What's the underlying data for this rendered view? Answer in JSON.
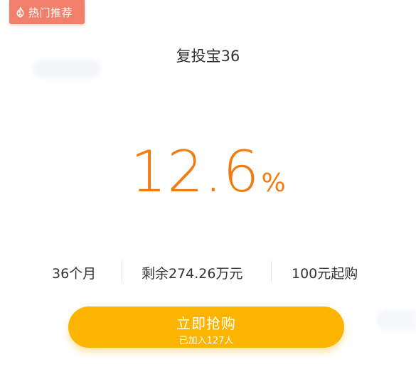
{
  "badge": {
    "label": "热门推荐",
    "icon": "flame-icon",
    "color": "#f0806a"
  },
  "product": {
    "title": "复投宝36"
  },
  "rate": {
    "value": "12.6",
    "unit": "%",
    "color": "#f07c12"
  },
  "info": {
    "term": "36个月",
    "remaining": "剩余274.26万元",
    "min_purchase": "100元起购"
  },
  "buy_button": {
    "label": "立即抢购",
    "sub_label": "已加入127人",
    "color": "#fcb400"
  }
}
